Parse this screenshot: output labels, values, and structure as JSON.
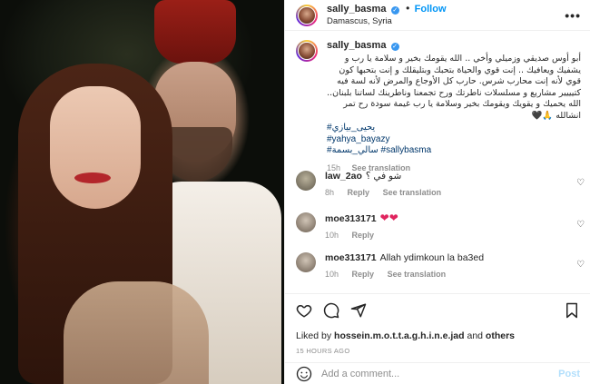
{
  "header": {
    "username": "sally_basma",
    "separator": "•",
    "follow_label": "Follow",
    "location": "Damascus, Syria",
    "more_label": "•••"
  },
  "caption": {
    "username": "sally_basma",
    "text": "أبو أوس صديقي وزميلي وأخي .. الله يقومك بخير و سلامة يا رب و يشفيك ويعافيك .. إنت قوي والحياة بتحبك وبتليقلك و إنت بتحبها كون قوي لأنه إنت محارب شرس. حارب كل الأوجاع والمرض لأنه لسة فيه كتيييير مشاريع و مسلسلات ناطرتك ورح تجمعنا وناطرينك لساتنا بلبنان.. الله يحميك و يقويك ويقومك بخير وسلامة يا رب غيمة سودة رح تمر انشالله 🙏🖤",
    "tags": [
      "#يحيى_بيازي",
      "#yahya_bayazy",
      "#سالي_بسمة #sallybasma"
    ],
    "time": "15h",
    "see_translation": "See translation"
  },
  "comments": [
    {
      "user": "law_2ao",
      "text": "شو في ؟",
      "time": "8h",
      "reply": "Reply",
      "translation": "See translation"
    },
    {
      "user": "moe313171",
      "text": "❤❤",
      "time": "10h",
      "reply": "Reply",
      "translation": ""
    },
    {
      "user": "moe313171",
      "text": "Allah ydimkoun la ba3ed",
      "time": "10h",
      "reply": "Reply",
      "translation": "See translation"
    }
  ],
  "likes": {
    "prefix": "Liked by ",
    "user": "hossein.m.o.t.t.a.g.h.i.n.e.jad",
    "middle": " and ",
    "others": "others"
  },
  "timestamp": "15 HOURS AGO",
  "add_comment": {
    "placeholder": "Add a comment...",
    "post_label": "Post"
  },
  "icons": {
    "verified": "verified-badge-icon",
    "heart": "heart-icon",
    "comment": "comment-icon",
    "share": "share-icon",
    "save": "bookmark-icon",
    "emoji": "smiley-icon"
  },
  "colors": {
    "follow": "#0095f6",
    "verified": "#3897f0",
    "tag": "#00376b",
    "muted": "#8e8e8e",
    "post_disabled": "#b2dffc"
  }
}
